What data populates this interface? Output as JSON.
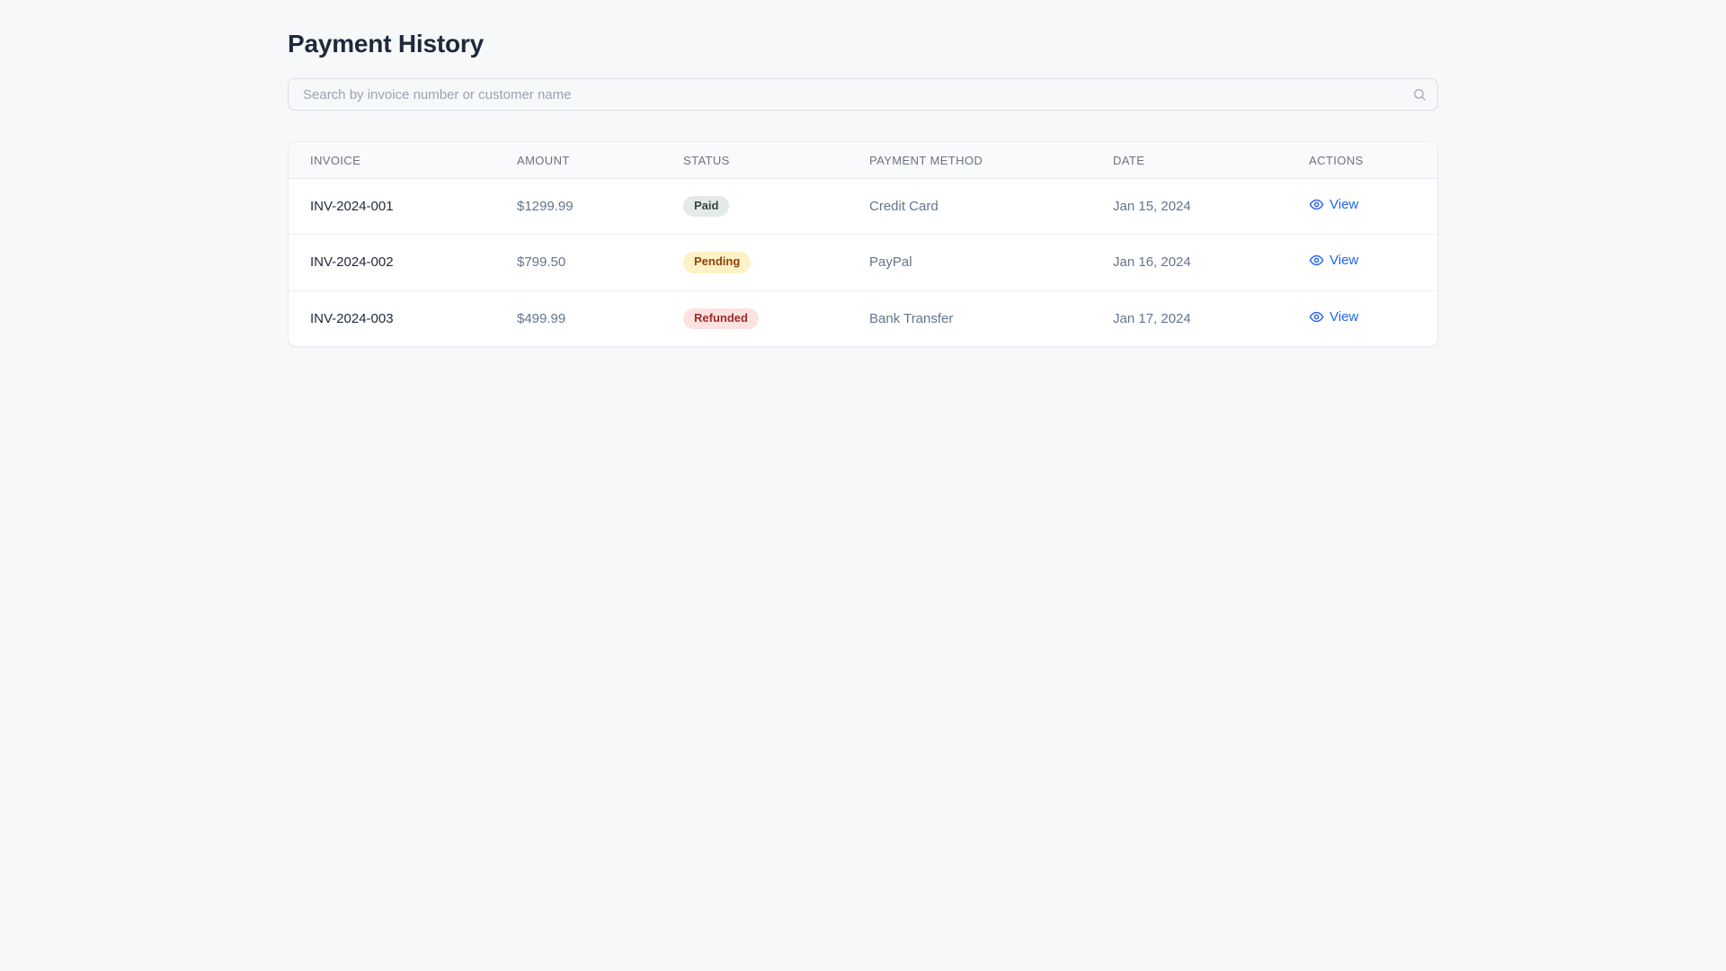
{
  "page": {
    "title": "Payment History"
  },
  "search": {
    "placeholder": "Search by invoice number or customer name",
    "value": "",
    "icon": "search-icon"
  },
  "table": {
    "columns": {
      "invoice": "Invoice",
      "amount": "Amount",
      "status": "Status",
      "payment_method": "Payment Method",
      "date": "Date",
      "actions": "Actions"
    },
    "rows": [
      {
        "invoice": "INV-2024-001",
        "amount": "$1299.99",
        "status": "Paid",
        "status_key": "paid",
        "payment_method": "Credit Card",
        "date": "Jan 15, 2024",
        "action_label": "View",
        "action_icon": "eye-icon"
      },
      {
        "invoice": "INV-2024-002",
        "amount": "$799.50",
        "status": "Pending",
        "status_key": "pending",
        "payment_method": "PayPal",
        "date": "Jan 16, 2024",
        "action_label": "View",
        "action_icon": "eye-icon"
      },
      {
        "invoice": "INV-2024-003",
        "amount": "$499.99",
        "status": "Refunded",
        "status_key": "refunded",
        "payment_method": "Bank Transfer",
        "date": "Jan 17, 2024",
        "action_label": "View",
        "action_icon": "eye-icon"
      }
    ]
  },
  "colors": {
    "page_background": "#f7f8fa",
    "title_text": "#1e293b",
    "link_accent": "#2563eb",
    "badge_paid_bg": "#e4eae6",
    "badge_paid_text": "#35463f",
    "badge_pending_bg": "#fdf2c5",
    "badge_pending_text": "#92400e",
    "badge_refunded_bg": "#fde2e1",
    "badge_refunded_text": "#9b2c2c"
  }
}
